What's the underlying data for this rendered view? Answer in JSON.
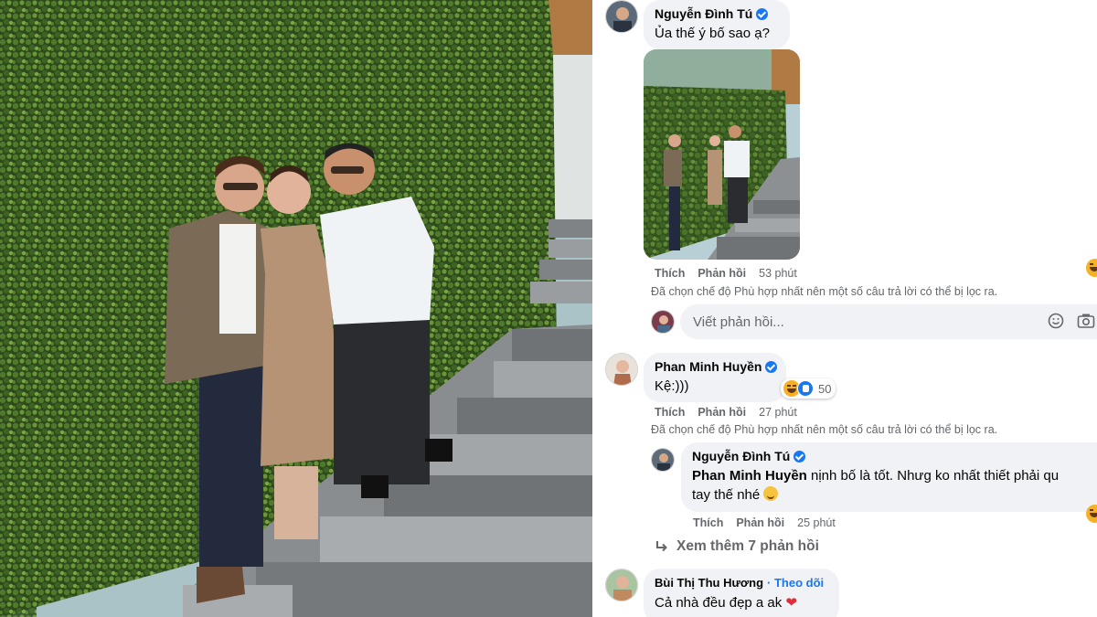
{
  "comments": [
    {
      "author": "Nguyễn Đình Tú",
      "verified": true,
      "text": "Ủa thế ý bố sao ạ?",
      "actions": {
        "like": "Thích",
        "reply": "Phản hồi",
        "time": "53 phút"
      },
      "filter_note": "Đã chọn chế độ Phù hợp nhất nên một số câu trả lời có thể bị lọc ra.",
      "reply_placeholder": "Viết phản hồi..."
    },
    {
      "author": "Phan Minh Huyền",
      "verified": true,
      "text": "Kệ:)))",
      "reaction_count": "50",
      "actions": {
        "like": "Thích",
        "reply": "Phản hồi",
        "time": "27 phút"
      },
      "filter_note": "Đã chọn chế độ Phù hợp nhất nên một số câu trả lời có thể bị lọc ra.",
      "reply": {
        "author": "Nguyễn Đình Tú",
        "verified": true,
        "mention": "Phan Minh Huyền",
        "text_line1": " nịnh bố là tốt. Nhưg ko nhất thiết phải qu",
        "text_line2": "tay thế nhé",
        "actions": {
          "like": "Thích",
          "reply": "Phản hồi",
          "time": "25 phút"
        }
      },
      "see_more": "Xem thêm 7 phản hồi"
    },
    {
      "author": "Bùi Thị Thu Hương",
      "follow": "· Theo dõi",
      "text": "Cả nhà đều đẹp a ak"
    }
  ],
  "colors": {
    "link": "#1877f2",
    "bubble": "#f0f2f5",
    "meta": "#65676b",
    "heart": "#e02c3b"
  },
  "icons": [
    "verified-badge-icon",
    "smile-icon",
    "camera-icon",
    "reply-arrow-icon",
    "haha-reaction-icon",
    "like-reaction-icon",
    "heart-icon"
  ]
}
